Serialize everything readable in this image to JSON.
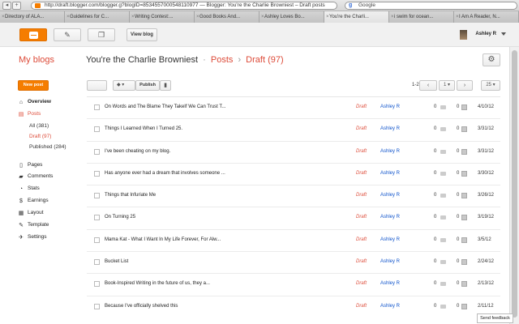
{
  "browser": {
    "url": "http://draft.blogger.com/blogger.g?blogID=8534557000548110977 — Blogger: You're the Charlie Browniest – Draft posts",
    "search_placeholder": "Google",
    "tabs": [
      "Directory of ALA...",
      "Guidelines for C...",
      "Writing Contest:...",
      "Good Books And...",
      "Ashley Loves Bo...",
      "You're the Charli...",
      "i swim for ocean...",
      "I Am A Reader, N..."
    ],
    "active_tab_index": 5
  },
  "topbar": {
    "view_blog_label": "View blog",
    "user_name": "Ashley R"
  },
  "header": {
    "my_blogs": "My blogs",
    "blog_title": "You're the Charlie Browniest",
    "crumb_posts": "Posts",
    "crumb_draft": "Draft (97)",
    "separator": "·",
    "arrow": "›"
  },
  "sidebar": {
    "new_post": "New post",
    "items": {
      "overview": "Overview",
      "posts": "Posts",
      "all": "All (381)",
      "draft": "Draft (97)",
      "published": "Published (284)",
      "pages": "Pages",
      "comments": "Comments",
      "stats": "Stats",
      "earnings": "Earnings",
      "layout": "Layout",
      "template": "Template",
      "settings": "Settings"
    }
  },
  "toolbar": {
    "publish_label": "Publish",
    "range": "1-25 of 97",
    "page": "1",
    "page_size": "25"
  },
  "posts": [
    {
      "title": "On Words and The Blame They TakeIf We Can Trust T...",
      "status": "Draft",
      "author": "Ashley R",
      "comments": "0",
      "views": "0",
      "date": "4/10/12"
    },
    {
      "title": "Things I Learned When I Turned 25.",
      "status": "Draft",
      "author": "Ashley R",
      "comments": "0",
      "views": "0",
      "date": "3/31/12"
    },
    {
      "title": "I've been cheating on my blog.",
      "status": "Draft",
      "author": "Ashley R",
      "comments": "0",
      "views": "0",
      "date": "3/31/12"
    },
    {
      "title": "Has anyone ever had a dream that involves someone ...",
      "status": "Draft",
      "author": "Ashley R",
      "comments": "0",
      "views": "0",
      "date": "3/30/12"
    },
    {
      "title": "Things that Infuriate Me",
      "status": "Draft",
      "author": "Ashley R",
      "comments": "0",
      "views": "0",
      "date": "3/26/12"
    },
    {
      "title": "On Turning 25",
      "status": "Draft",
      "author": "Ashley R",
      "comments": "0",
      "views": "0",
      "date": "3/19/12"
    },
    {
      "title": "Mama Kat - What I Want In My Life Forever, For Alw...",
      "status": "Draft",
      "author": "Ashley R",
      "comments": "0",
      "views": "0",
      "date": "3/5/12"
    },
    {
      "title": "Bucket List",
      "status": "Draft",
      "author": "Ashley R",
      "comments": "0",
      "views": "0",
      "date": "2/24/12"
    },
    {
      "title": "Book-Inspired Writing in the future of us, they a...",
      "status": "Draft",
      "author": "Ashley R",
      "comments": "0",
      "views": "0",
      "date": "2/13/12"
    },
    {
      "title": "Because I've officially shelved this",
      "status": "Draft",
      "author": "Ashley R",
      "comments": "0",
      "views": "0",
      "date": "2/11/12"
    }
  ],
  "footer": {
    "send_feedback": "Send feedback"
  },
  "colors": {
    "brand_orange": "#f57d00",
    "accent_red": "#dd4b39",
    "link_blue": "#1155cc"
  }
}
